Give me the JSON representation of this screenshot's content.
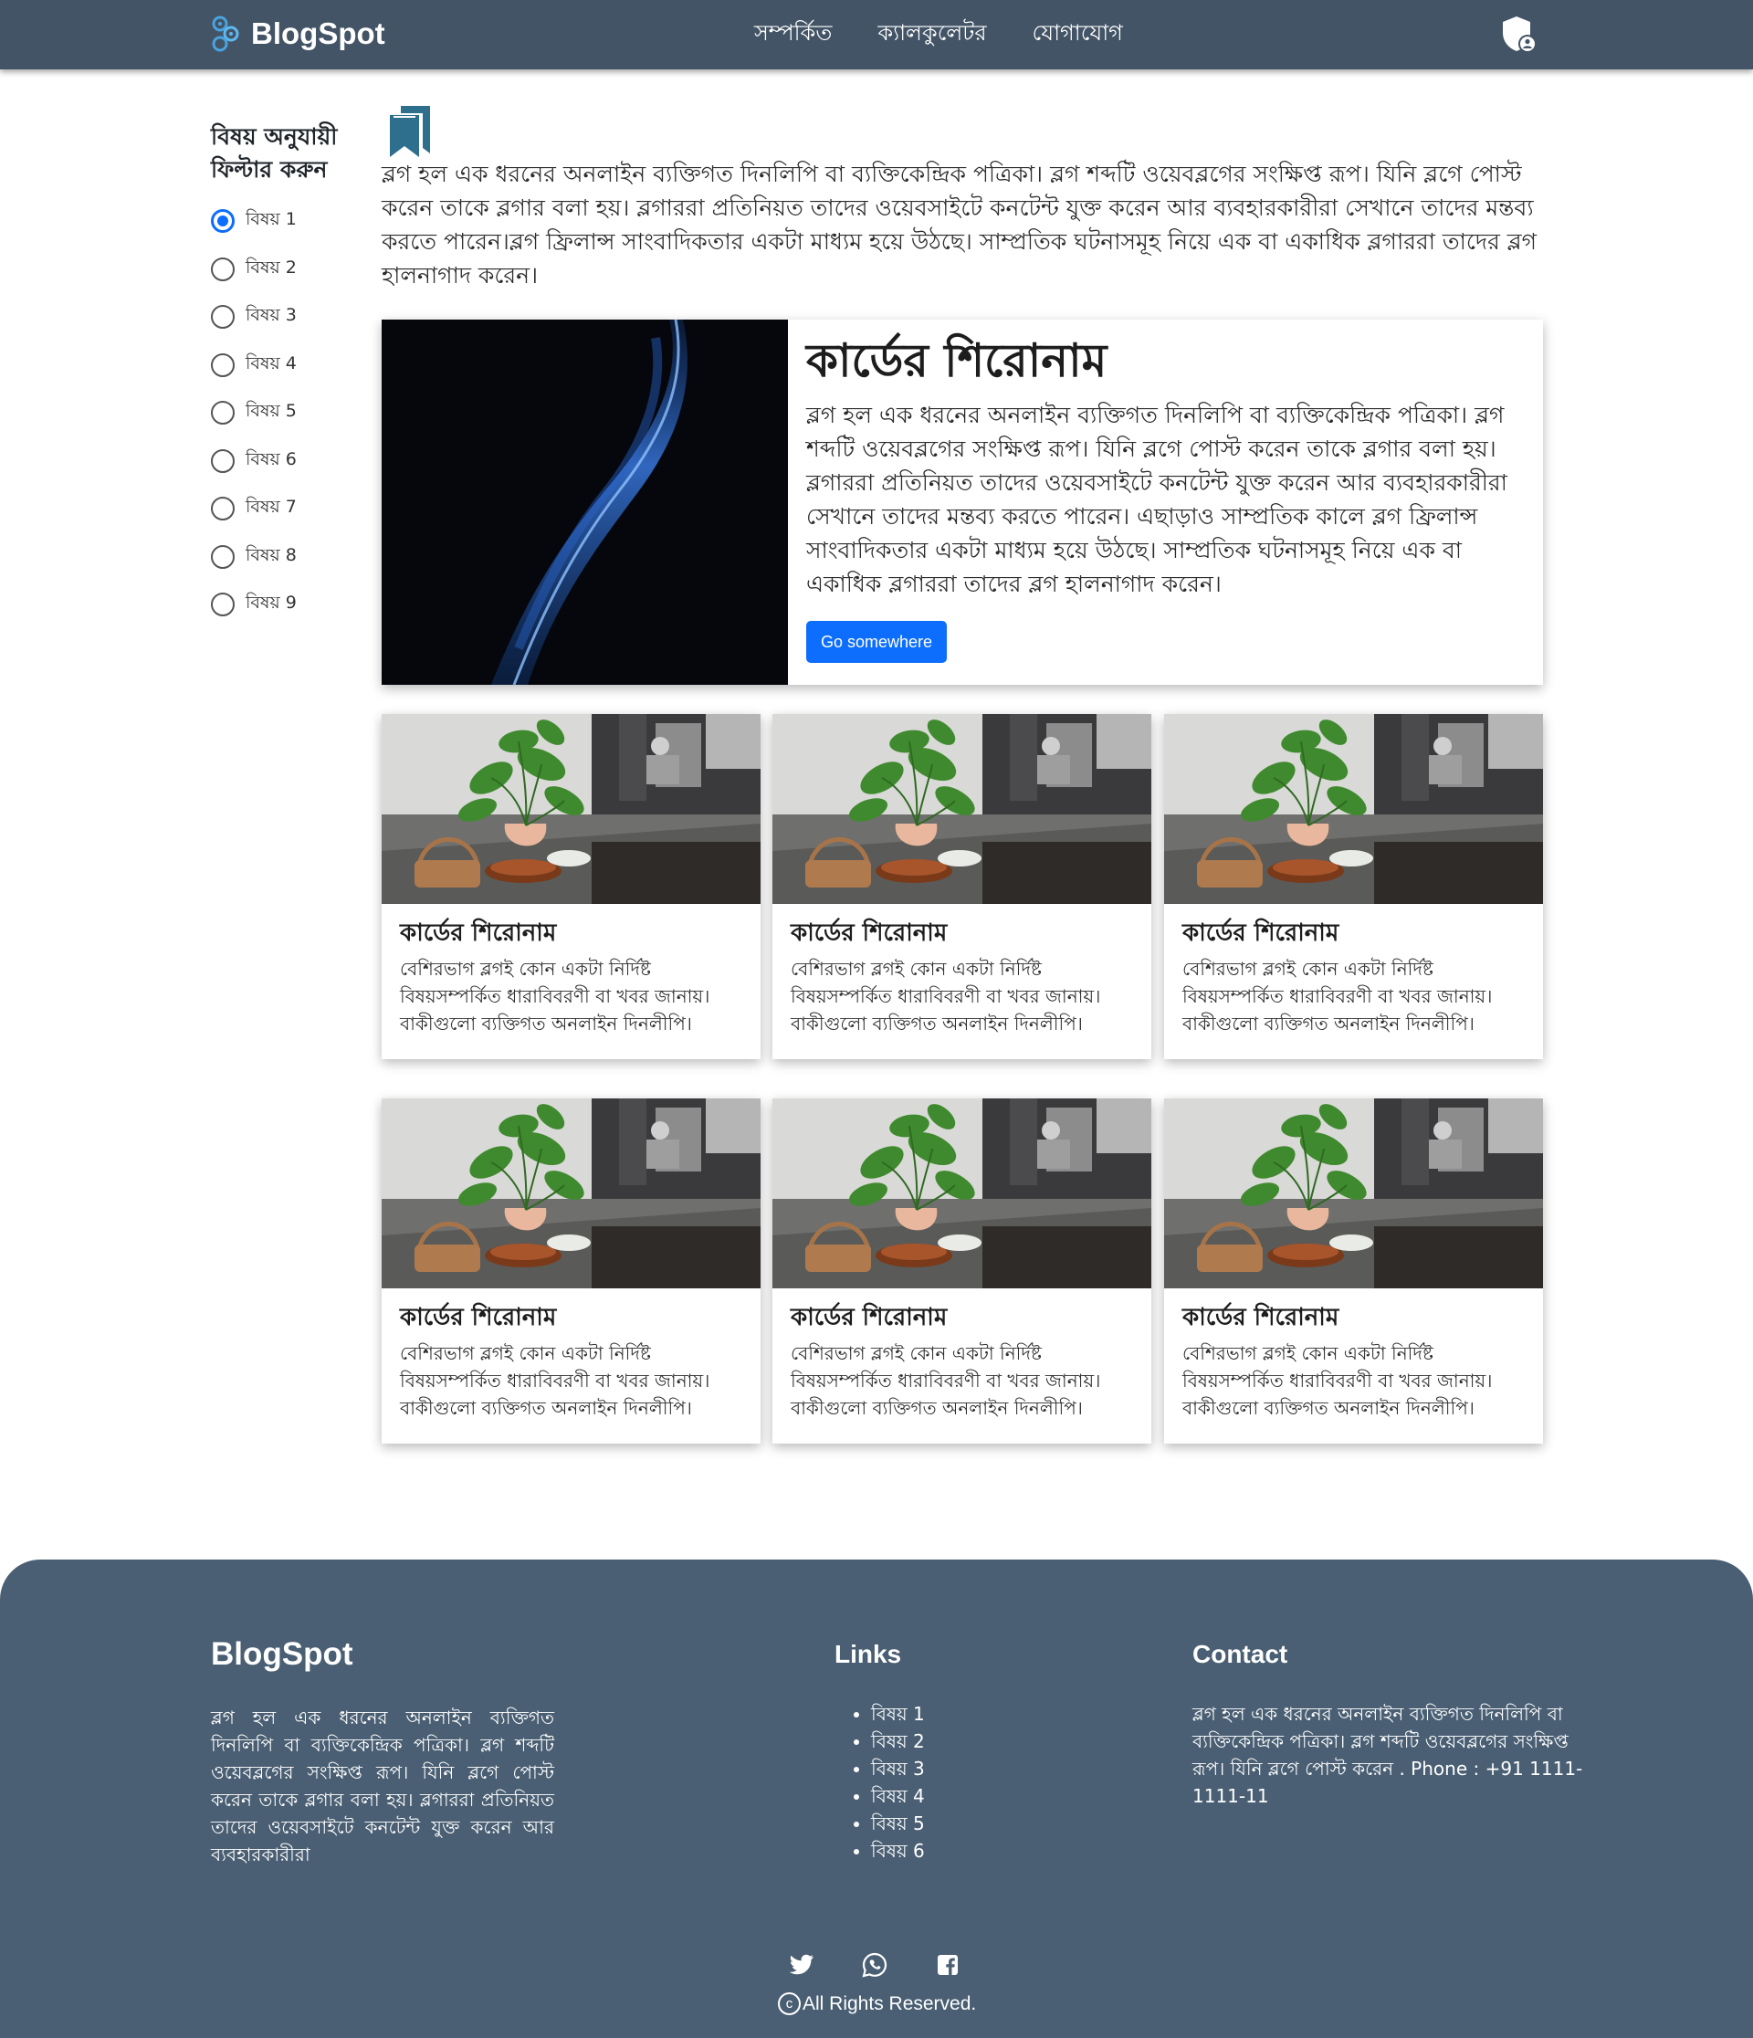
{
  "nav": {
    "brand": "BlogSpot",
    "links": [
      "সম্পর্কিত",
      "ক্যালকুলেটর",
      "যোগাযোগ"
    ]
  },
  "sidebar": {
    "title": "বিষয় অনুযায়ী ফিল্টার করুন",
    "filters": [
      "বিষয় 1",
      "বিষয় 2",
      "বিষয় 3",
      "বিষয় 4",
      "বিষয় 5",
      "বিষয় 6",
      "বিষয় 7",
      "বিষয় 8",
      "বিষয় 9"
    ],
    "selected": "বিষয় 1"
  },
  "intro": {
    "text": "ব্লগ হল এক ধরনের অনলাইন ব্যক্তিগত দিনলিপি বা ব্যক্তিকেন্দ্রিক পত্রিকা। ব্লগ শব্দটি ওয়েবব্লগের সংক্ষিপ্ত রূপ। যিনি ব্লগে পোস্ট করেন তাকে ব্লগার বলা হয়। ব্লগাররা প্রতিনিয়ত তাদের ওয়েবসাইটে কনটেন্ট যুক্ত করেন আর ব্যবহারকারীরা সেখানে তাদের মন্তব্য করতে পারেন।ব্লগ ফ্রিলান্স সাংবাদিকতার একটা মাধ্যম হয়ে উঠছে। সাম্প্রতিক ঘটনাসমূহ নিয়ে এক বা একাধিক ব্লগাররা তাদের ব্লগ হালনাগাদ করেন।"
  },
  "hero": {
    "title": "কার্ডের শিরোনাম",
    "text": "ব্লগ হল এক ধরনের অনলাইন ব্যক্তিগত দিনলিপি বা ব্যক্তিকেন্দ্রিক পত্রিকা। ব্লগ শব্দটি ওয়েবব্লগের সংক্ষিপ্ত রূপ। যিনি ব্লগে পোস্ট করেন তাকে ব্লগার বলা হয়। ব্লগাররা প্রতিনিয়ত তাদের ওয়েবসাইটে কনটেন্ট যুক্ত করেন আর ব্যবহারকারীরা সেখানে তাদের মন্তব্য করতে পারেন। এছাড়াও সাম্প্রতিক কালে ব্লগ ফ্রিলান্স সাংবাদিকতার একটা মাধ্যম হয়ে উঠছে। সাম্প্রতিক ঘটনাসমূহ নিয়ে এক বা একাধিক ব্লগাররা তাদের ব্লগ হালনাগাদ করেন।",
    "button": "Go somewhere"
  },
  "cards": [
    {
      "title": "কার্ডের শিরোনাম",
      "text": "বেশিরভাগ ব্লগই কোন একটা নির্দিষ্ট বিষয়সম্পর্কিত ধারাবিবরণী বা খবর জানায়। বাকীগুলো ব্যক্তিগত অনলাইন দিনলীপি।"
    },
    {
      "title": "কার্ডের শিরোনাম",
      "text": "বেশিরভাগ ব্লগই কোন একটা নির্দিষ্ট বিষয়সম্পর্কিত ধারাবিবরণী বা খবর জানায়। বাকীগুলো ব্যক্তিগত অনলাইন দিনলীপি।"
    },
    {
      "title": "কার্ডের শিরোনাম",
      "text": "বেশিরভাগ ব্লগই কোন একটা নির্দিষ্ট বিষয়সম্পর্কিত ধারাবিবরণী বা খবর জানায়। বাকীগুলো ব্যক্তিগত অনলাইন দিনলীপি।"
    },
    {
      "title": "কার্ডের শিরোনাম",
      "text": "বেশিরভাগ ব্লগই কোন একটা নির্দিষ্ট বিষয়সম্পর্কিত ধারাবিবরণী বা খবর জানায়। বাকীগুলো ব্যক্তিগত অনলাইন দিনলীপি।"
    },
    {
      "title": "কার্ডের শিরোনাম",
      "text": "বেশিরভাগ ব্লগই কোন একটা নির্দিষ্ট বিষয়সম্পর্কিত ধারাবিবরণী বা খবর জানায়। বাকীগুলো ব্যক্তিগত অনলাইন দিনলীপি।"
    },
    {
      "title": "কার্ডের শিরোনাম",
      "text": "বেশিরভাগ ব্লগই কোন একটা নির্দিষ্ট বিষয়সম্পর্কিত ধারাবিবরণী বা খবর জানায়। বাকীগুলো ব্যক্তিগত অনলাইন দিনলীপি।"
    }
  ],
  "footer": {
    "brand": "BlogSpot",
    "about": "ব্লগ হল এক ধরনের অনলাইন ব্যক্তিগত দিনলিপি বা ব্যক্তিকেন্দ্রিক পত্রিকা। ব্লগ শব্দটি ওয়েবব্লগের সংক্ষিপ্ত রূপ। যিনি ব্লগে পোস্ট করেন তাকে ব্লগার বলা হয়। ব্লগাররা প্রতিনিয়ত তাদের ওয়েবসাইটে কনটেন্ট যুক্ত করেন আর ব্যবহারকারীরা",
    "links_heading": "Links",
    "links": [
      "বিষয় 1",
      "বিষয় 2",
      "বিষয় 3",
      "বিষয় 4",
      "বিষয় 5",
      "বিষয় 6"
    ],
    "contact_heading": "Contact",
    "contact": "ব্লগ হল এক ধরনের অনলাইন ব্যক্তিগত দিনলিপি বা ব্যক্তিকেন্দ্রিক পত্রিকা। ব্লগ শব্দটি ওয়েবব্লগের সংক্ষিপ্ত রূপ। যিনি ব্লগে পোস্ট করেন . Phone : +91 1111-1111-11",
    "socials": [
      "twitter-icon",
      "whatsapp-icon",
      "facebook-icon"
    ],
    "copyright": "All Rights Reserved."
  },
  "colors": {
    "navbar": "#435466",
    "footer": "#4a5f73",
    "primary": "#0d6efd",
    "bookmark": "#2e6f8e"
  }
}
